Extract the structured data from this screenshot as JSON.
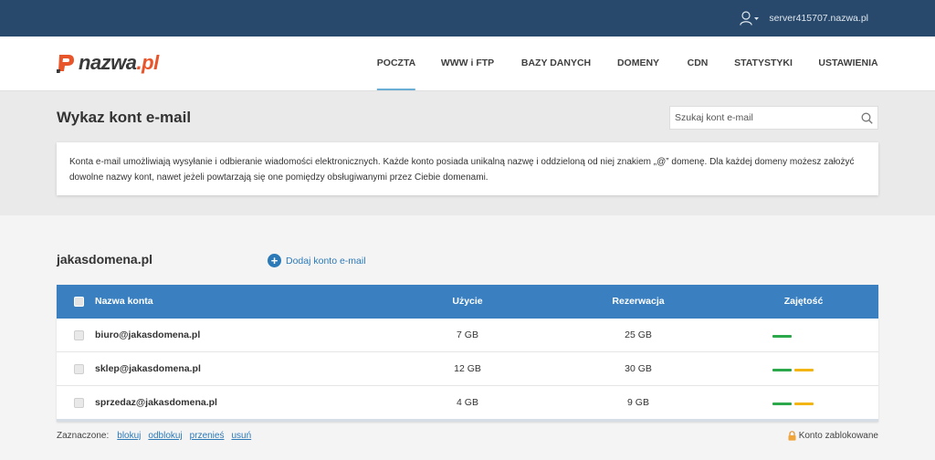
{
  "topbar": {
    "server_name": "server415707.nazwa.pl"
  },
  "logo": {
    "name": "nazwa",
    "tld": ".pl"
  },
  "nav": {
    "items": [
      {
        "label": "POCZTA",
        "active": true
      },
      {
        "label": "WWW i FTP",
        "active": false
      },
      {
        "label": "BAZY DANYCH",
        "active": false
      },
      {
        "label": "DOMENY",
        "active": false
      },
      {
        "label": "CDN",
        "active": false
      },
      {
        "label": "STATYSTYKI",
        "active": false
      },
      {
        "label": "USTAWIENIA",
        "active": false
      }
    ]
  },
  "page": {
    "title": "Wykaz kont e-mail",
    "search_placeholder": "Szukaj kont e-mail",
    "info_text": "Konta e-mail umożliwiają wysyłanie i odbieranie wiadomości elektronicznych. Każde konto posiada unikalną nazwę i oddzieloną od niej znakiem „@” domenę. Dla każdej domeny możesz założyć dowolne nazwy kont, nawet jeżeli powtarzają się one pomiędzy obsługiwanymi przez Ciebie domenami."
  },
  "domain": {
    "name": "jakasdomena.pl",
    "add_label": "Dodaj konto e-mail"
  },
  "table": {
    "headers": {
      "name": "Nazwa konta",
      "usage": "Użycie",
      "reservation": "Rezerwacja",
      "occupancy": "Zajętość"
    },
    "rows": [
      {
        "name": "biuro@jakasdomena.pl",
        "usage": "7 GB",
        "reservation": "25 GB",
        "occupancy_pct": 28
      },
      {
        "name": "sklep@jakasdomena.pl",
        "usage": "12 GB",
        "reservation": "30 GB",
        "occupancy_pct": 40
      },
      {
        "name": "sprzedaz@jakasdomena.pl",
        "usage": "4 GB",
        "reservation": "9 GB",
        "occupancy_pct": 44
      }
    ]
  },
  "footer": {
    "selected_label": "Zaznaczone:",
    "actions": {
      "block": "blokuj",
      "unblock": "odblokuj",
      "move": "przenieś",
      "delete": "usuń"
    },
    "locked_label": "Konto zablokowane"
  },
  "colors": {
    "topbar": "#28496b",
    "table_header": "#3a80c1",
    "link": "#2c79b8",
    "bar_green": "#2aa84a",
    "bar_yellow": "#f2b514",
    "logo_accent": "#e8552b"
  }
}
